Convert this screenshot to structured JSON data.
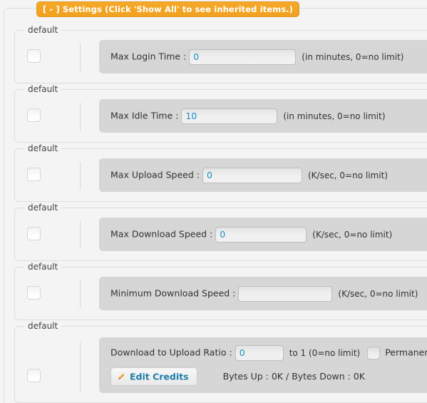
{
  "window": {
    "title": "[ - ] Settings (Click 'Show All' to see inherited items.)"
  },
  "groups": [
    {
      "legend": "default",
      "label": "Max Login Time :",
      "value": "0",
      "hint": "(in minutes, 0=no limit)",
      "input_width": 150
    },
    {
      "legend": "default",
      "label": "Max Idle Time :",
      "value": "10",
      "hint": "(in minutes, 0=no limit)",
      "input_width": 135
    },
    {
      "legend": "default",
      "label": "Max Upload Speed :",
      "value": "0",
      "hint": "(K/sec, 0=no limit)",
      "input_width": 140
    },
    {
      "legend": "default",
      "label": "Max Download Speed :",
      "value": "0",
      "hint": "(K/sec, 0=no limit)",
      "input_width": 128
    },
    {
      "legend": "default",
      "label": "Minimum Download Speed :",
      "value": "",
      "hint": "(K/sec, 0=no limit)",
      "input_width": 132
    }
  ],
  "ratio_group": {
    "legend": "default",
    "label": "Download to Upload Ratio :",
    "value": "0",
    "hint": "to 1 (0=no limit)",
    "permanent_label": "Permanent Ratio",
    "edit_credits_label": "Edit Credits",
    "credits_text": "Bytes Up : 0K / Bytes Down : 0K",
    "input_width": 68
  },
  "colors": {
    "accent_orange": "#f6a828",
    "link_blue": "#1d7ea8",
    "value_blue": "#1d8fc4",
    "panel_gray": "#d6d6d6",
    "page_bg": "#f4f4f4"
  }
}
